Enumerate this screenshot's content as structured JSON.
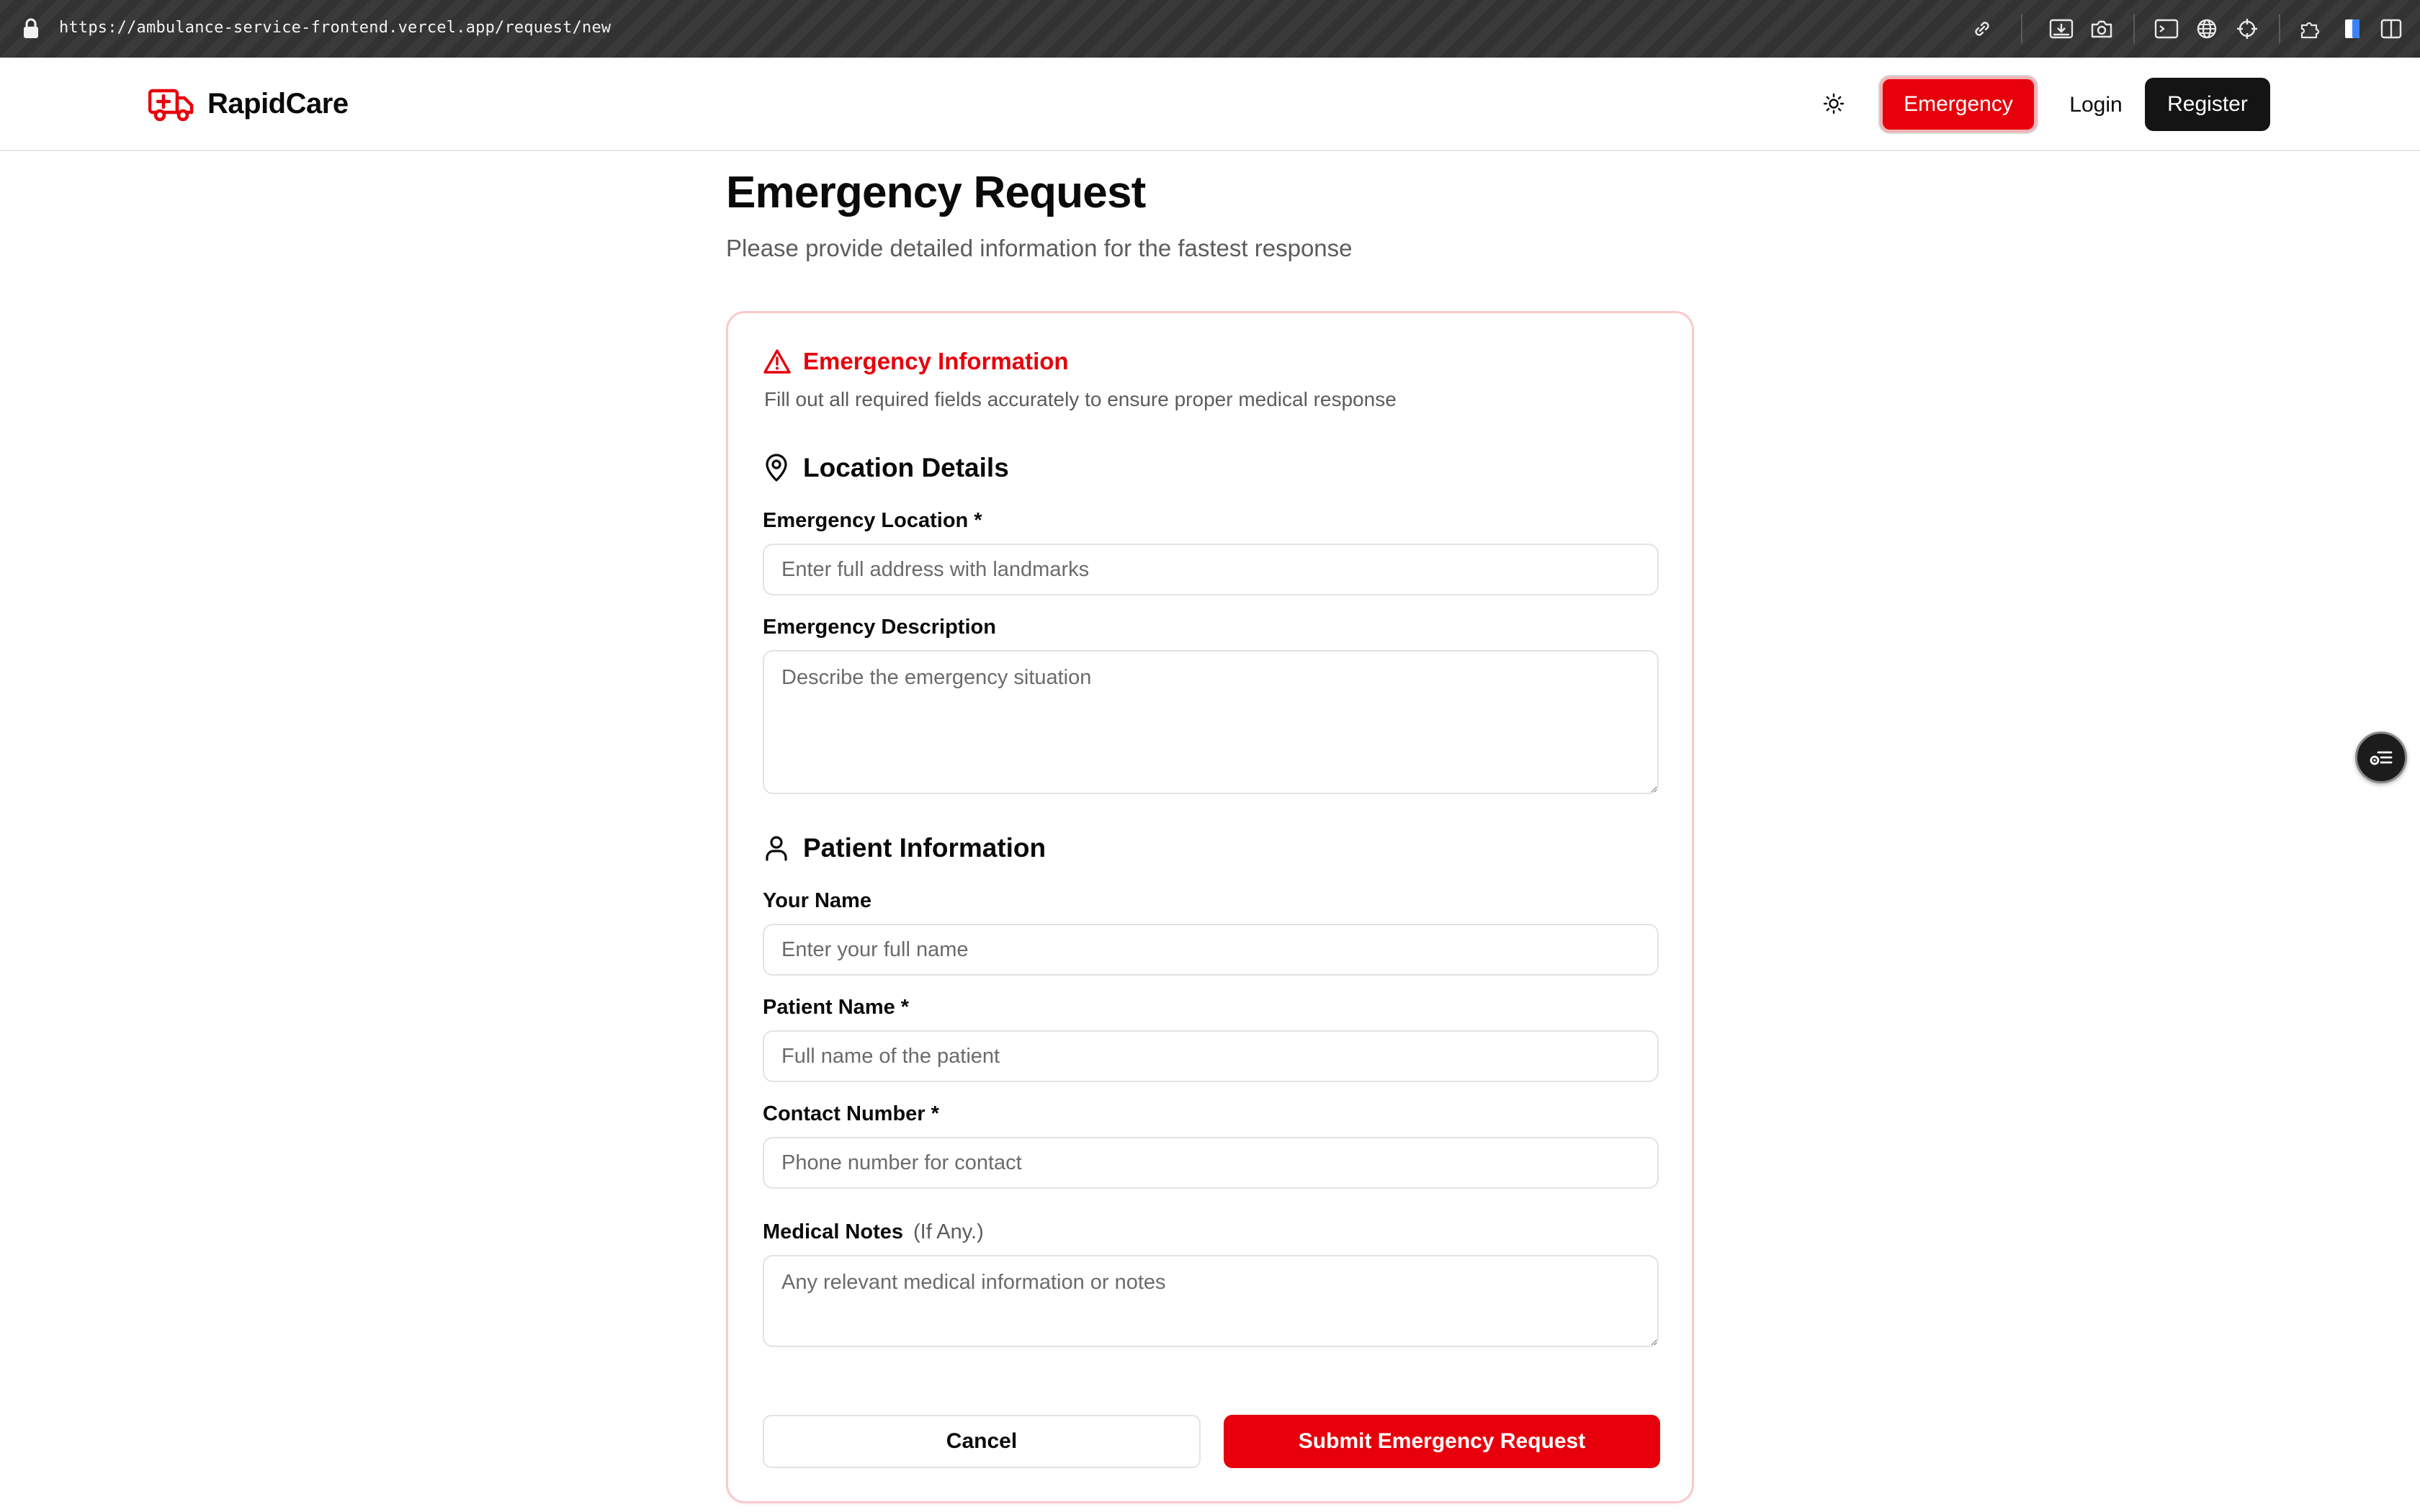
{
  "browser": {
    "url": "https://ambulance-service-frontend.vercel.app/request/new",
    "icons": [
      "link-icon",
      "image-download-icon",
      "camera-icon",
      "terminal-icon",
      "globe-icon",
      "crosshair-icon",
      "puzzle-icon",
      "bookmark-icon",
      "sidebar-icon"
    ]
  },
  "header": {
    "brand": "RapidCare",
    "emergency_label": "Emergency",
    "login_label": "Login",
    "register_label": "Register"
  },
  "page": {
    "title": "Emergency Request",
    "subtitle": "Please provide detailed information for the fastest response"
  },
  "card": {
    "title": "Emergency Information",
    "description": "Fill out all required fields accurately to ensure proper medical response"
  },
  "location": {
    "section_title": "Location Details",
    "location_label": "Emergency Location *",
    "location_placeholder": "Enter full address with landmarks",
    "description_label": "Emergency Description",
    "description_placeholder": "Describe the emergency situation"
  },
  "patient": {
    "section_title": "Patient Information",
    "your_name_label": "Your Name",
    "your_name_placeholder": "Enter your full name",
    "patient_name_label": "Patient Name *",
    "patient_name_placeholder": "Full name of the patient",
    "contact_label": "Contact Number *",
    "contact_placeholder": "Phone number for contact",
    "notes_label": "Medical Notes",
    "notes_hint": "(If Any.)",
    "notes_placeholder": "Any relevant medical information or notes"
  },
  "actions": {
    "cancel_label": "Cancel",
    "submit_label": "Submit Emergency Request"
  },
  "colors": {
    "accent": "#e7000b",
    "card_border": "#fbc9cc",
    "dark_button": "#141414"
  }
}
